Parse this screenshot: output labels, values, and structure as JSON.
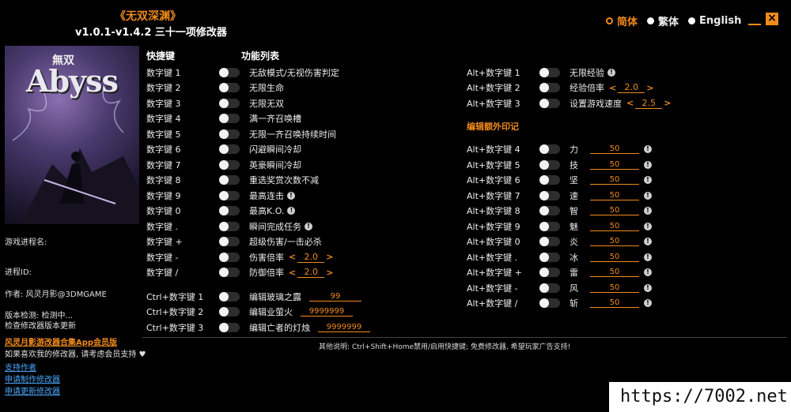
{
  "header": {
    "title": "《无双深渊》",
    "version_line": "v1.0.1-v1.4.2 三十一项修改器"
  },
  "languages": [
    {
      "label": "简体",
      "selected": true
    },
    {
      "label": "繁体",
      "selected": false
    },
    {
      "label": "English",
      "selected": false
    }
  ],
  "cover": {
    "logo_text": "Abyss",
    "logo_sub": "無双"
  },
  "sidebar": {
    "process_label": "游戏进程名:",
    "pid_label": "进程ID:",
    "author": "作者: 风灵月影@3DMGAME",
    "version_check": "版本检测: 检测中...",
    "update_check": "检查修改器版本更新",
    "app_link": "风灵月影游改器合集App会员版",
    "support_text": "如果喜欢我的修改器, 请考虑会员支持",
    "links": [
      "支持作者",
      "申请制作修改器",
      "申请更新修改器"
    ]
  },
  "columns": {
    "hotkey": "快捷键",
    "function_list": "功能列表"
  },
  "left_options": [
    {
      "key": "数字键 1",
      "label": "无敌模式/无视伤害判定"
    },
    {
      "key": "数字键 2",
      "label": "无限生命"
    },
    {
      "key": "数字键 3",
      "label": "无限无双"
    },
    {
      "key": "数字键 4",
      "label": "满一齐召唤槽"
    },
    {
      "key": "数字键 5",
      "label": "无限一齐召唤持续时间"
    },
    {
      "key": "数字键 6",
      "label": "闪避瞬间冷却"
    },
    {
      "key": "数字键 7",
      "label": "英豪瞬间冷却"
    },
    {
      "key": "数字键 8",
      "label": "重选奖赏次数不减"
    },
    {
      "key": "数字键 9",
      "label": "最高连击",
      "info": true
    },
    {
      "key": "数字键 0",
      "label": "最高K.O.",
      "info": true
    },
    {
      "key": "数字键 .",
      "label": "瞬间完成任务",
      "info": true
    },
    {
      "key": "数字键 +",
      "label": "超级伤害/一击必杀"
    },
    {
      "key": "数字键 -",
      "label": "伤害倍率",
      "stepper": "2.0"
    },
    {
      "key": "数字键 /",
      "label": "防御倍率",
      "stepper": "2.0"
    }
  ],
  "ctrl_options": [
    {
      "key": "Ctrl+数字键 1",
      "label": "编辑玻璃之露",
      "value": "99"
    },
    {
      "key": "Ctrl+数字键 2",
      "label": "编辑业萤火",
      "value": "9999999"
    },
    {
      "key": "Ctrl+数字键 3",
      "label": "编辑亡者的灯烛",
      "value": "9999999"
    }
  ],
  "alt_options": [
    {
      "key": "Alt+数字键 1",
      "label": "无限经验",
      "info": true
    },
    {
      "key": "Alt+数字键 2",
      "label": "经验倍率",
      "stepper": "2.0"
    },
    {
      "key": "Alt+数字键 3",
      "label": "设置游戏速度",
      "stepper": "2.5"
    }
  ],
  "section_title": "编辑额外印记",
  "imprint_options": [
    {
      "key": "Alt+数字键 4",
      "label": "力",
      "value": "50"
    },
    {
      "key": "Alt+数字键 5",
      "label": "技",
      "value": "50"
    },
    {
      "key": "Alt+数字键 6",
      "label": "坚",
      "value": "50"
    },
    {
      "key": "Alt+数字键 7",
      "label": "速",
      "value": "50"
    },
    {
      "key": "Alt+数字键 8",
      "label": "智",
      "value": "50"
    },
    {
      "key": "Alt+数字键 9",
      "label": "魅",
      "value": "50"
    },
    {
      "key": "Alt+数字键 0",
      "label": "炎",
      "value": "50"
    },
    {
      "key": "Alt+数字键 .",
      "label": "冰",
      "value": "50"
    },
    {
      "key": "Alt+数字键 +",
      "label": "雷",
      "value": "50"
    },
    {
      "key": "Alt+数字键 -",
      "label": "风",
      "value": "50"
    },
    {
      "key": "Alt+数字键 /",
      "label": "斩",
      "value": "50"
    }
  ],
  "footer_note": "其他说明: Ctrl+Shift+Home禁用/启用快捷键; 免费修改器, 希望玩家广告支持!",
  "watermark": "https://7002.net",
  "colors": {
    "accent": "#f08a1c",
    "background": "#000000",
    "link": "#4aa8ff"
  }
}
